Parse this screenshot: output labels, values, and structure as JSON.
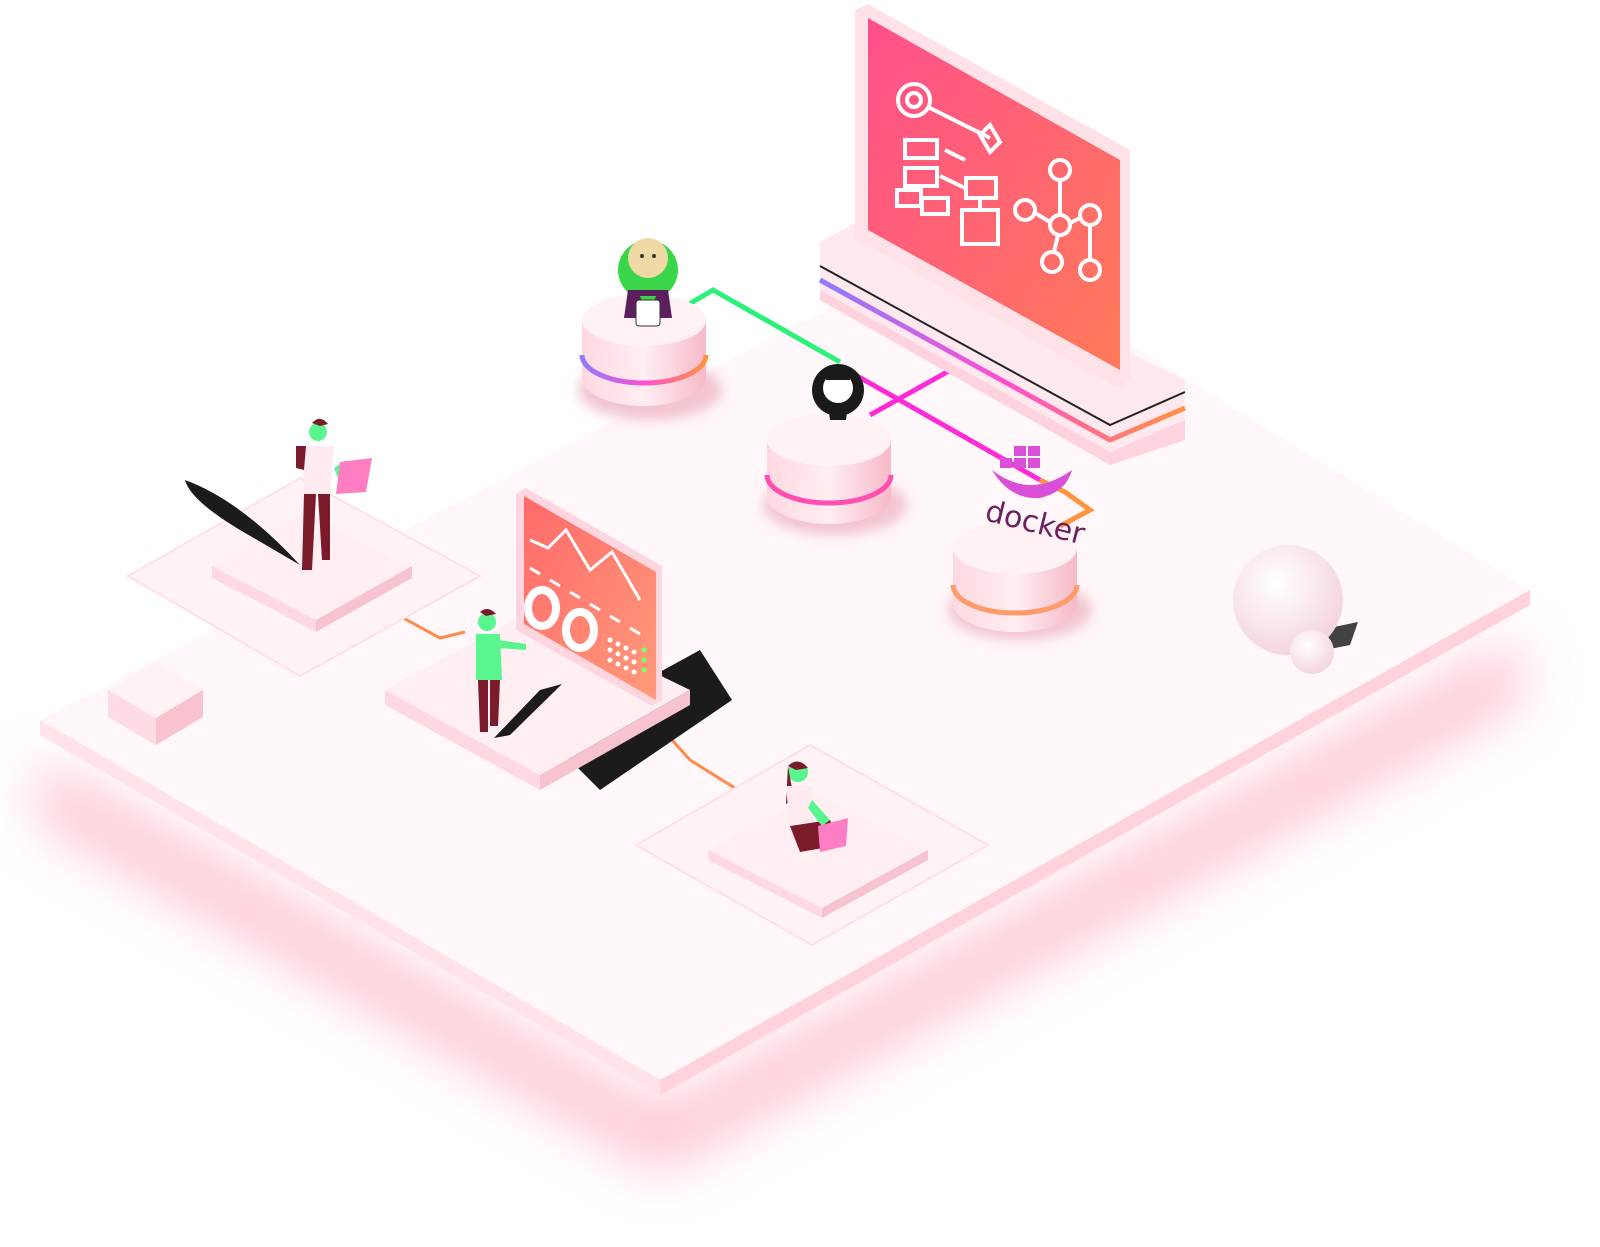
{
  "illustration": {
    "logos": {
      "jenkins": {
        "icon": "jenkins-butler-icon"
      },
      "github": {
        "icon": "github-octocat-icon"
      },
      "docker": {
        "label": "docker",
        "icon": "docker-whale-icon"
      }
    },
    "monitors": {
      "main": {
        "icons": [
          "gear-icon",
          "flowchart-icon",
          "node-graph-icon"
        ]
      },
      "dashboard": {
        "icons": [
          "line-chart-icon",
          "donut-icon",
          "dot-grid-icon"
        ]
      }
    },
    "colors": {
      "accent_gradient_start": "#ff4f8b",
      "accent_gradient_end": "#ff7a59",
      "platform": "#fff6f8",
      "platform_glow": "#ff8fa6",
      "connector_green": "#2bf07a",
      "connector_magenta": "#ff2bd6",
      "connector_orange": "#ff9440",
      "figure_shirt": "#59f58f",
      "figure_pants": "#7a1a2a",
      "docker_magenta": "#d94fd8"
    }
  }
}
